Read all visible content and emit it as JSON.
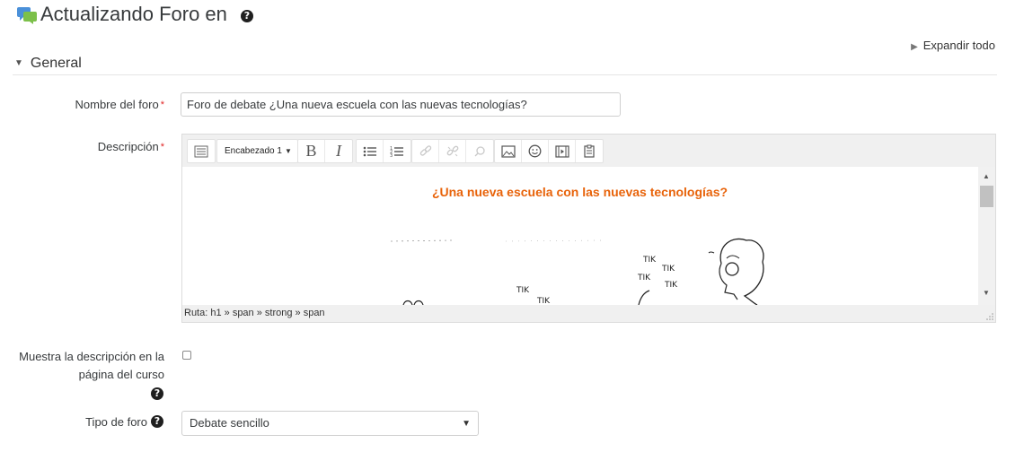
{
  "header": {
    "title": "Actualizando Foro en",
    "icon": "forum-icon",
    "help_icon": "question-circle-icon"
  },
  "expand_all": "Expandir todo",
  "section": {
    "title": "General"
  },
  "fields": {
    "name": {
      "label": "Nombre del foro",
      "required_mark": "*",
      "value": "Foro de debate ¿Una nueva escuela con las nuevas tecnologías?"
    },
    "description": {
      "label": "Descripción",
      "required_mark": "*"
    },
    "show_description": {
      "label_line1": "Muestra la descripción en la",
      "label_line2": "página del curso",
      "checked": false
    },
    "forum_type": {
      "label": "Tipo de foro",
      "value": "Debate sencillo"
    }
  },
  "editor": {
    "heading_format": "Encabezado 1",
    "toolbar_icons": [
      "toolbar-toggle-icon",
      "heading-select",
      "bold-icon",
      "italic-icon",
      "unordered-list-icon",
      "ordered-list-icon",
      "link-icon",
      "unlink-icon",
      "anchor-icon",
      "image-icon",
      "emoticon-icon",
      "media-icon",
      "paste-icon"
    ],
    "bold_label": "B",
    "italic_label": "I",
    "content_heading": "¿Una nueva escuela con las nuevas tecnologías?",
    "illustration_labels": [
      "TIK",
      "TIK",
      "TIK",
      "TIK",
      "TIK",
      "TIK"
    ],
    "path": "Ruta: h1 » span » strong » span"
  },
  "colors": {
    "accent_heading": "#e8630a",
    "required": "#e02424"
  }
}
